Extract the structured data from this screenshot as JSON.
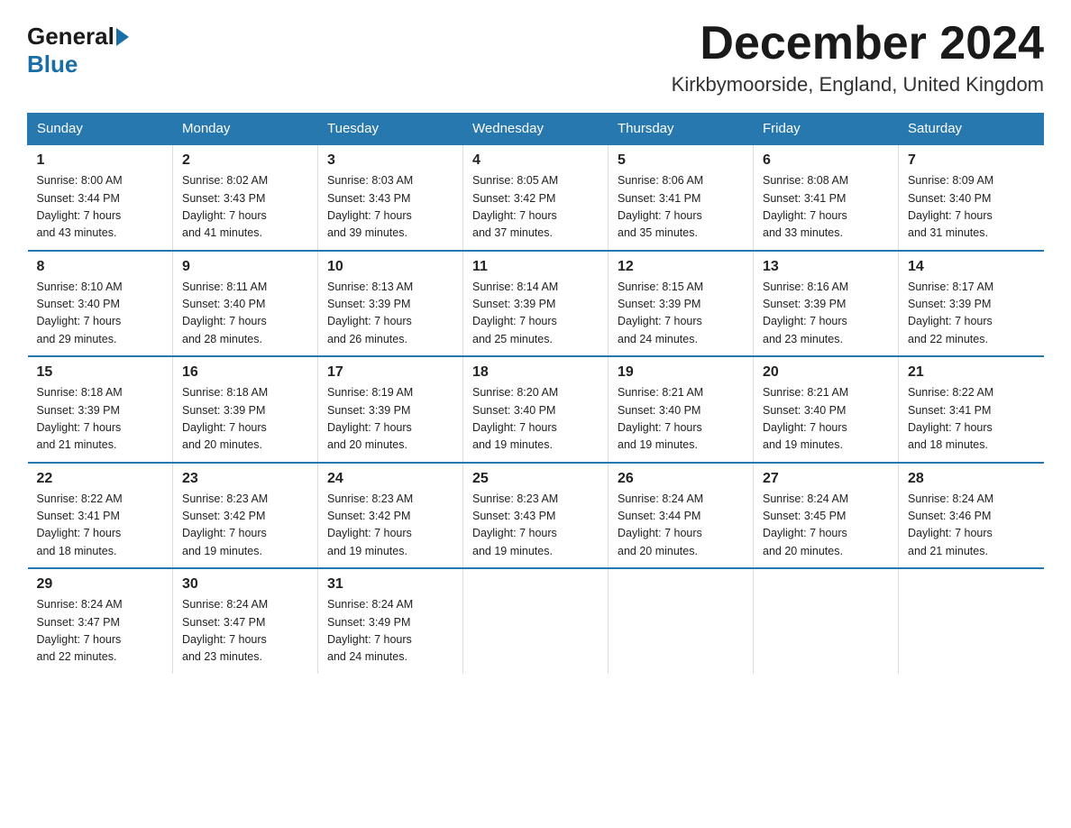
{
  "header": {
    "logo_general": "General",
    "logo_blue": "Blue",
    "month_year": "December 2024",
    "location": "Kirkbymoorside, England, United Kingdom"
  },
  "days_of_week": [
    "Sunday",
    "Monday",
    "Tuesday",
    "Wednesday",
    "Thursday",
    "Friday",
    "Saturday"
  ],
  "weeks": [
    [
      {
        "day": "1",
        "sunrise": "8:00 AM",
        "sunset": "3:44 PM",
        "daylight": "7 hours and 43 minutes."
      },
      {
        "day": "2",
        "sunrise": "8:02 AM",
        "sunset": "3:43 PM",
        "daylight": "7 hours and 41 minutes."
      },
      {
        "day": "3",
        "sunrise": "8:03 AM",
        "sunset": "3:43 PM",
        "daylight": "7 hours and 39 minutes."
      },
      {
        "day": "4",
        "sunrise": "8:05 AM",
        "sunset": "3:42 PM",
        "daylight": "7 hours and 37 minutes."
      },
      {
        "day": "5",
        "sunrise": "8:06 AM",
        "sunset": "3:41 PM",
        "daylight": "7 hours and 35 minutes."
      },
      {
        "day": "6",
        "sunrise": "8:08 AM",
        "sunset": "3:41 PM",
        "daylight": "7 hours and 33 minutes."
      },
      {
        "day": "7",
        "sunrise": "8:09 AM",
        "sunset": "3:40 PM",
        "daylight": "7 hours and 31 minutes."
      }
    ],
    [
      {
        "day": "8",
        "sunrise": "8:10 AM",
        "sunset": "3:40 PM",
        "daylight": "7 hours and 29 minutes."
      },
      {
        "day": "9",
        "sunrise": "8:11 AM",
        "sunset": "3:40 PM",
        "daylight": "7 hours and 28 minutes."
      },
      {
        "day": "10",
        "sunrise": "8:13 AM",
        "sunset": "3:39 PM",
        "daylight": "7 hours and 26 minutes."
      },
      {
        "day": "11",
        "sunrise": "8:14 AM",
        "sunset": "3:39 PM",
        "daylight": "7 hours and 25 minutes."
      },
      {
        "day": "12",
        "sunrise": "8:15 AM",
        "sunset": "3:39 PM",
        "daylight": "7 hours and 24 minutes."
      },
      {
        "day": "13",
        "sunrise": "8:16 AM",
        "sunset": "3:39 PM",
        "daylight": "7 hours and 23 minutes."
      },
      {
        "day": "14",
        "sunrise": "8:17 AM",
        "sunset": "3:39 PM",
        "daylight": "7 hours and 22 minutes."
      }
    ],
    [
      {
        "day": "15",
        "sunrise": "8:18 AM",
        "sunset": "3:39 PM",
        "daylight": "7 hours and 21 minutes."
      },
      {
        "day": "16",
        "sunrise": "8:18 AM",
        "sunset": "3:39 PM",
        "daylight": "7 hours and 20 minutes."
      },
      {
        "day": "17",
        "sunrise": "8:19 AM",
        "sunset": "3:39 PM",
        "daylight": "7 hours and 20 minutes."
      },
      {
        "day": "18",
        "sunrise": "8:20 AM",
        "sunset": "3:40 PM",
        "daylight": "7 hours and 19 minutes."
      },
      {
        "day": "19",
        "sunrise": "8:21 AM",
        "sunset": "3:40 PM",
        "daylight": "7 hours and 19 minutes."
      },
      {
        "day": "20",
        "sunrise": "8:21 AM",
        "sunset": "3:40 PM",
        "daylight": "7 hours and 19 minutes."
      },
      {
        "day": "21",
        "sunrise": "8:22 AM",
        "sunset": "3:41 PM",
        "daylight": "7 hours and 18 minutes."
      }
    ],
    [
      {
        "day": "22",
        "sunrise": "8:22 AM",
        "sunset": "3:41 PM",
        "daylight": "7 hours and 18 minutes."
      },
      {
        "day": "23",
        "sunrise": "8:23 AM",
        "sunset": "3:42 PM",
        "daylight": "7 hours and 19 minutes."
      },
      {
        "day": "24",
        "sunrise": "8:23 AM",
        "sunset": "3:42 PM",
        "daylight": "7 hours and 19 minutes."
      },
      {
        "day": "25",
        "sunrise": "8:23 AM",
        "sunset": "3:43 PM",
        "daylight": "7 hours and 19 minutes."
      },
      {
        "day": "26",
        "sunrise": "8:24 AM",
        "sunset": "3:44 PM",
        "daylight": "7 hours and 20 minutes."
      },
      {
        "day": "27",
        "sunrise": "8:24 AM",
        "sunset": "3:45 PM",
        "daylight": "7 hours and 20 minutes."
      },
      {
        "day": "28",
        "sunrise": "8:24 AM",
        "sunset": "3:46 PM",
        "daylight": "7 hours and 21 minutes."
      }
    ],
    [
      {
        "day": "29",
        "sunrise": "8:24 AM",
        "sunset": "3:47 PM",
        "daylight": "7 hours and 22 minutes."
      },
      {
        "day": "30",
        "sunrise": "8:24 AM",
        "sunset": "3:47 PM",
        "daylight": "7 hours and 23 minutes."
      },
      {
        "day": "31",
        "sunrise": "8:24 AM",
        "sunset": "3:49 PM",
        "daylight": "7 hours and 24 minutes."
      },
      null,
      null,
      null,
      null
    ]
  ],
  "labels": {
    "sunrise": "Sunrise:",
    "sunset": "Sunset:",
    "daylight": "Daylight:"
  }
}
